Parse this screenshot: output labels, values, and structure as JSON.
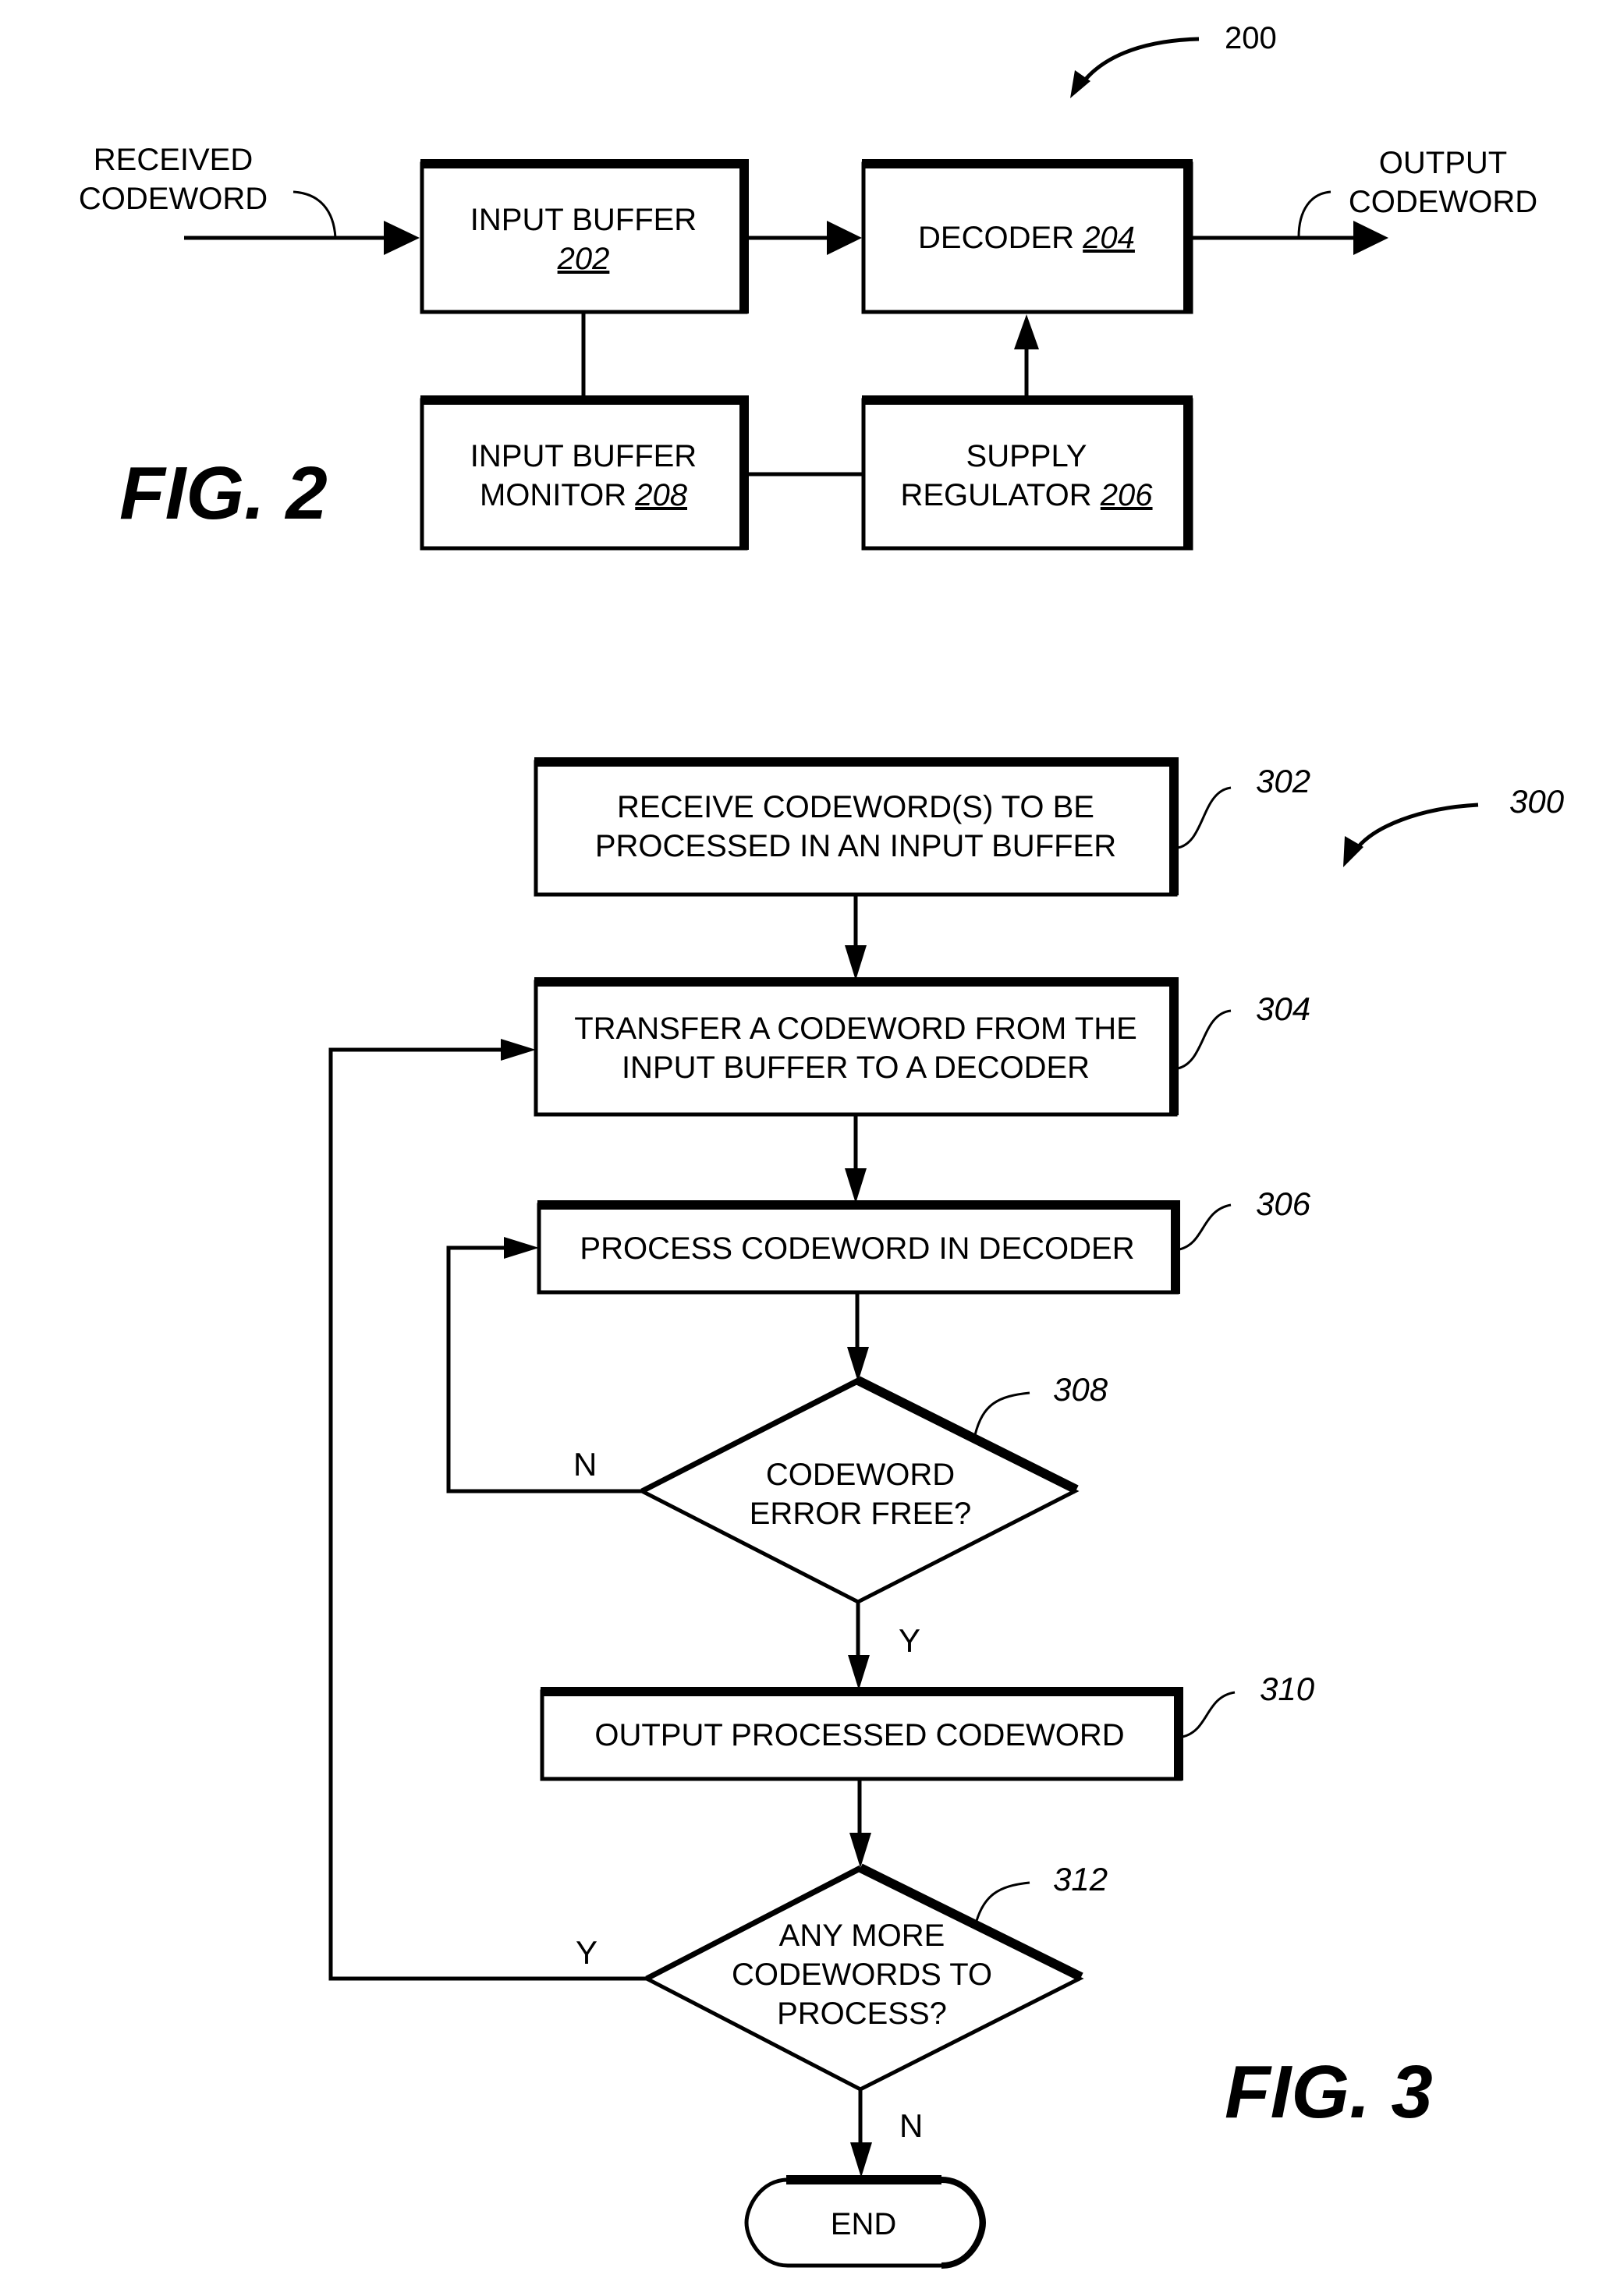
{
  "fig2": {
    "caption": "FIG. 2",
    "ref": "200",
    "input_label": [
      "RECEIVED",
      "CODEWORD"
    ],
    "output_label": [
      "OUTPUT",
      "CODEWORD"
    ],
    "input_buffer": {
      "line1": "INPUT BUFFER",
      "ref": "202"
    },
    "decoder": {
      "line1": "DECODER ",
      "ref": "204"
    },
    "monitor": {
      "line1": "INPUT BUFFER",
      "line2": "MONITOR ",
      "ref": "208"
    },
    "regulator": {
      "line1": "SUPPLY",
      "line2": "REGULATOR ",
      "ref": "206"
    }
  },
  "fig3": {
    "caption": "FIG. 3",
    "ref": "300",
    "steps": [
      {
        "ref": "302",
        "lines": [
          "RECEIVE CODEWORD(S) TO BE",
          "PROCESSED IN AN INPUT BUFFER"
        ]
      },
      {
        "ref": "304",
        "lines": [
          "TRANSFER A CODEWORD FROM THE",
          "INPUT BUFFER TO A DECODER"
        ]
      },
      {
        "ref": "306",
        "lines": [
          "PROCESS CODEWORD IN DECODER"
        ]
      },
      {
        "ref": "308",
        "lines": [
          "CODEWORD",
          "ERROR FREE?"
        ]
      },
      {
        "ref": "310",
        "lines": [
          "OUTPUT PROCESSED CODEWORD"
        ]
      },
      {
        "ref": "312",
        "lines": [
          "ANY MORE",
          "CODEWORDS TO",
          "PROCESS?"
        ]
      }
    ],
    "end_label": "END",
    "branch_308_no": "N",
    "branch_308_yes": "Y",
    "branch_312_yes": "Y",
    "branch_312_no": "N"
  }
}
